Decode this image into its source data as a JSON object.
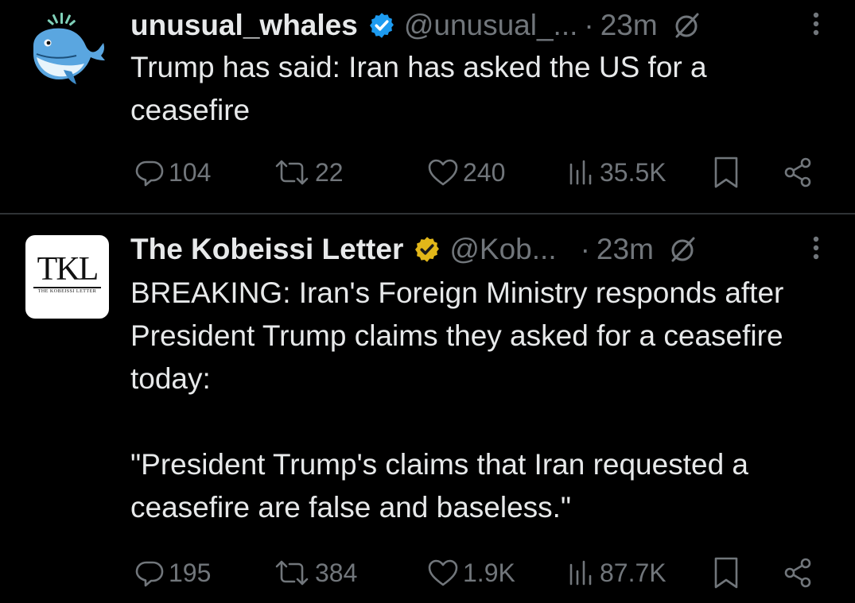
{
  "tweets": [
    {
      "author_name": "unusual_whales",
      "handle": "@unusual_...",
      "separator": "·",
      "time": "23m",
      "text": "Trump has said: Iran has asked the US for a ceasefire",
      "verified_badge": "blue-verified-badge-icon",
      "badge_color": "#1d9bf0",
      "avatar": "unusual-whales-logo",
      "replies": "104",
      "reposts": "22",
      "likes": "240",
      "views": "35.5K"
    },
    {
      "author_name": "The Kobeissi Letter",
      "handle": "@Kob...",
      "separator": "·",
      "time": "23m",
      "text": "BREAKING: Iran's Foreign Ministry responds after President Trump claims they asked for a ceasefire today:\n\n\"President Trump's claims that Iran requested a ceasefire are false and baseless.\"",
      "verified_badge": "gold-verified-badge-icon",
      "badge_color": "#e2b719",
      "avatar": "the-kobeissi-letter-logo",
      "avatar_mark": "TKL",
      "avatar_subtitle": "THE KOBEISSI LETTER",
      "replies": "195",
      "reposts": "384",
      "likes": "1.9K",
      "views": "87.7K"
    }
  ],
  "colors": {
    "background": "#000000",
    "text": "#e7e9ea",
    "muted": "#71767b",
    "divider": "#2f3336"
  }
}
